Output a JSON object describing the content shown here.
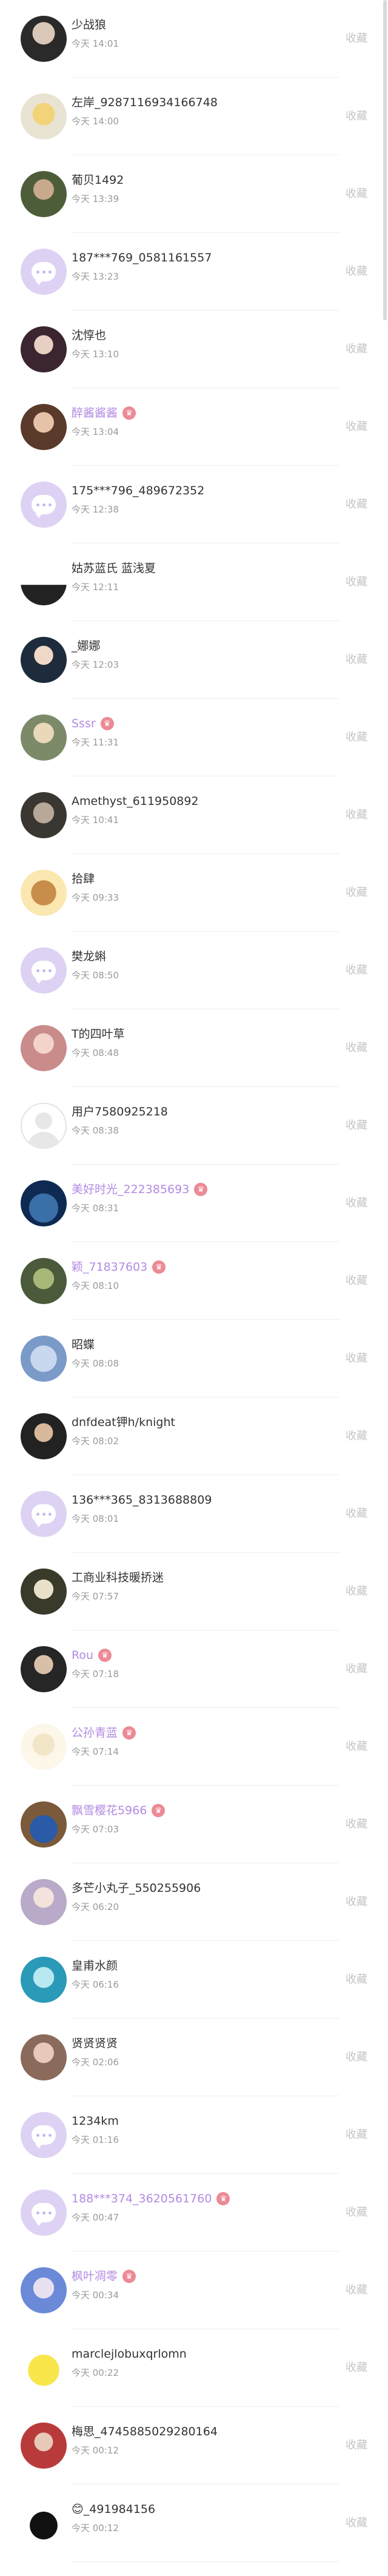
{
  "collect_label": "收藏",
  "colors": {
    "member_name": "#b28ae2",
    "vip_badge": "#ec8a95",
    "placeholder_avatar": "#ddd2f3"
  },
  "users": [
    {
      "name": "少战狼",
      "time": "今天 14:01",
      "member": false,
      "avatar": "photo"
    },
    {
      "name": "左岸_9287116934166748",
      "time": "今天 14:00",
      "member": false,
      "avatar": "photo"
    },
    {
      "name": "葡贝1492",
      "time": "今天 13:39",
      "member": false,
      "avatar": "photo"
    },
    {
      "name": "187***769_0581161557",
      "time": "今天 13:23",
      "member": false,
      "avatar": "placeholder"
    },
    {
      "name": "沈惇也",
      "time": "今天 13:10",
      "member": false,
      "avatar": "photo"
    },
    {
      "name": "醉酱酱酱",
      "time": "今天 13:04",
      "member": true,
      "avatar": "photo"
    },
    {
      "name": "175***796_489672352",
      "time": "今天 12:38",
      "member": false,
      "avatar": "placeholder"
    },
    {
      "name": "姑苏蓝氏 蓝浅夏",
      "time": "今天 12:11",
      "member": false,
      "avatar": "photo"
    },
    {
      "name": "_娜娜",
      "time": "今天 12:03",
      "member": false,
      "avatar": "photo"
    },
    {
      "name": "Sssr",
      "time": "今天 11:31",
      "member": true,
      "avatar": "photo"
    },
    {
      "name": "Amethyst_611950892",
      "time": "今天 10:41",
      "member": false,
      "avatar": "photo"
    },
    {
      "name": "拾肆",
      "time": "今天 09:33",
      "member": false,
      "avatar": "photo"
    },
    {
      "name": "樊龙蝌",
      "time": "今天 08:50",
      "member": false,
      "avatar": "placeholder"
    },
    {
      "name": "T的四叶草",
      "time": "今天 08:48",
      "member": false,
      "avatar": "photo"
    },
    {
      "name": "用户7580925218",
      "time": "今天 08:38",
      "member": false,
      "avatar": "blank"
    },
    {
      "name": "美好时光_222385693",
      "time": "今天 08:31",
      "member": true,
      "avatar": "photo"
    },
    {
      "name": "颖_71837603",
      "time": "今天 08:10",
      "member": true,
      "avatar": "photo"
    },
    {
      "name": "昭蝶",
      "time": "今天 08:08",
      "member": false,
      "avatar": "photo"
    },
    {
      "name": "dnfdeat钾h/knight",
      "time": "今天 08:02",
      "member": false,
      "avatar": "photo"
    },
    {
      "name": "136***365_8313688809",
      "time": "今天 08:01",
      "member": false,
      "avatar": "placeholder"
    },
    {
      "name": "工商业科技暖挢迷",
      "time": "今天 07:57",
      "member": false,
      "avatar": "photo"
    },
    {
      "name": "Rou",
      "time": "今天 07:18",
      "member": true,
      "avatar": "photo"
    },
    {
      "name": "公孙青蓝",
      "time": "今天 07:14",
      "member": true,
      "avatar": "photo"
    },
    {
      "name": "飘雪樱花5966",
      "time": "今天 07:03",
      "member": true,
      "avatar": "photo"
    },
    {
      "name": "多芒小丸子_550255906",
      "time": "今天 06:20",
      "member": false,
      "avatar": "photo"
    },
    {
      "name": "皇甫水颜",
      "time": "今天 06:16",
      "member": false,
      "avatar": "photo"
    },
    {
      "name": "贤贤贤贤",
      "time": "今天 02:06",
      "member": false,
      "avatar": "photo"
    },
    {
      "name": "1234km",
      "time": "今天 01:16",
      "member": false,
      "avatar": "placeholder"
    },
    {
      "name": "188***374_3620561760",
      "time": "今天 00:47",
      "member": true,
      "avatar": "placeholder"
    },
    {
      "name": "枫叶凋零",
      "time": "今天 00:34",
      "member": true,
      "avatar": "photo"
    },
    {
      "name": "marclejlobuxqrlomn",
      "time": "今天 00:22",
      "member": false,
      "avatar": "photo"
    },
    {
      "name": "梅思_4745885029280164",
      "time": "今天 00:12",
      "member": false,
      "avatar": "photo"
    },
    {
      "name": "😊_491984156",
      "time": "今天 00:12",
      "member": false,
      "avatar": "photo"
    }
  ]
}
